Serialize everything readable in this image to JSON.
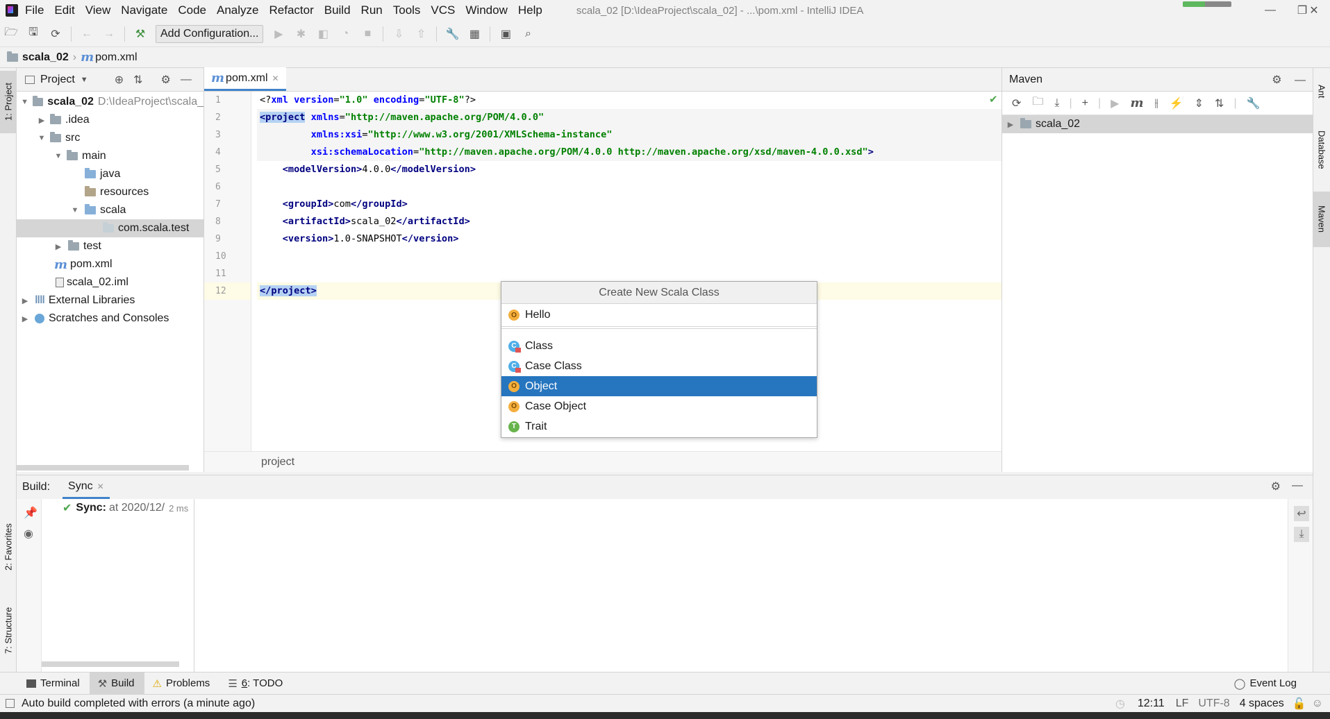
{
  "window": {
    "title": "scala_02 [D:\\IdeaProject\\scala_02] - ...\\pom.xml - IntelliJ IDEA"
  },
  "menu": [
    "File",
    "Edit",
    "View",
    "Navigate",
    "Code",
    "Analyze",
    "Refactor",
    "Build",
    "Run",
    "Tools",
    "VCS",
    "Window",
    "Help"
  ],
  "toolbar": {
    "add_configuration_label": "Add Configuration..."
  },
  "breadcrumb": {
    "project": "scala_02",
    "file": "pom.xml"
  },
  "left_strip": {
    "project_tab": "1: Project",
    "favorites_tab": "2: Favorites",
    "structure_tab": "7: Structure"
  },
  "project_panel": {
    "title": "Project",
    "tree": [
      {
        "label": "scala_02",
        "path": "D:\\IdeaProject\\scala_"
      },
      {
        "label": ".idea"
      },
      {
        "label": "src"
      },
      {
        "label": "main"
      },
      {
        "label": "java"
      },
      {
        "label": "resources"
      },
      {
        "label": "scala"
      },
      {
        "label": "com.scala.test"
      },
      {
        "label": "test"
      },
      {
        "label": "pom.xml"
      },
      {
        "label": "scala_02.iml"
      },
      {
        "label": "External Libraries"
      },
      {
        "label": "Scratches and Consoles"
      }
    ]
  },
  "editor": {
    "tab": "pom.xml",
    "line_numbers": [
      "1",
      "2",
      "3",
      "4",
      "5",
      "6",
      "7",
      "8",
      "9",
      "10",
      "11",
      "12"
    ],
    "breadcrumb": "project",
    "code": {
      "l1_a": "<?",
      "l1_b": "xml ",
      "l1_c": "version",
      "l1_d": "=",
      "l1_e": "\"1.0\"",
      "l1_f": " encoding",
      "l1_g": "=",
      "l1_h": "\"UTF-8\"",
      "l1_i": "?>",
      "l2_a": "<project",
      "l2_b": " xmlns",
      "l2_c": "=",
      "l2_d": "\"http://maven.apache.org/POM/4.0.0\"",
      "l3_pad": "         ",
      "l3_a": "xmlns:xsi",
      "l3_b": "=",
      "l3_c": "\"http://www.w3.org/2001/XMLSchema-instance\"",
      "l4_pad": "         ",
      "l4_a": "xsi:schemaLocation",
      "l4_b": "=",
      "l4_c": "\"http://maven.apache.org/POM/4.0.0 http://maven.apache.org/xsd/maven-4.0.0.xsd\"",
      "l4_d": ">",
      "l5_pad": "    ",
      "l5_a": "<modelVersion>",
      "l5_b": "4.0.0",
      "l5_c": "</modelVersion>",
      "l7_pad": "    ",
      "l7_a": "<groupId>",
      "l7_b": "com",
      "l7_c": "</groupId>",
      "l8_pad": "    ",
      "l8_a": "<artifactId>",
      "l8_b": "scala_02",
      "l8_c": "</artifactId>",
      "l9_pad": "    ",
      "l9_a": "<version>",
      "l9_b": "1.0-SNAPSHOT",
      "l9_c": "</version>",
      "l12_a": "</project>"
    }
  },
  "popup": {
    "title": "Create New Scala Class",
    "input_value": "Hello",
    "items": [
      {
        "label": "Class",
        "kind": "class"
      },
      {
        "label": "Case Class",
        "kind": "case-class"
      },
      {
        "label": "Object",
        "kind": "object",
        "selected": true
      },
      {
        "label": "Case Object",
        "kind": "case-object"
      },
      {
        "label": "Trait",
        "kind": "trait"
      }
    ]
  },
  "maven": {
    "title": "Maven",
    "project": "scala_02"
  },
  "right_strip": {
    "ant_tab": "Ant",
    "database_tab": "Database",
    "maven_tab": "Maven"
  },
  "build": {
    "label": "Build:",
    "tab": "Sync",
    "sync_label": "Sync:",
    "sync_time": "at 2020/12/",
    "sync_duration": "2 ms"
  },
  "bottom_tabs": {
    "terminal": "Terminal",
    "build": "Build",
    "problems": "Problems",
    "todo_prefix": "6",
    "todo": ": TODO",
    "event_log": "Event Log"
  },
  "statusbar": {
    "message": "Auto build completed with errors (a minute ago)",
    "position": "12:11",
    "line_sep": "LF",
    "encoding": "UTF-8",
    "indent": "4 spaces"
  },
  "colors": {
    "accent": "#2675bf",
    "tag": "#000080",
    "attr": "#0000ff",
    "string": "#008000"
  }
}
